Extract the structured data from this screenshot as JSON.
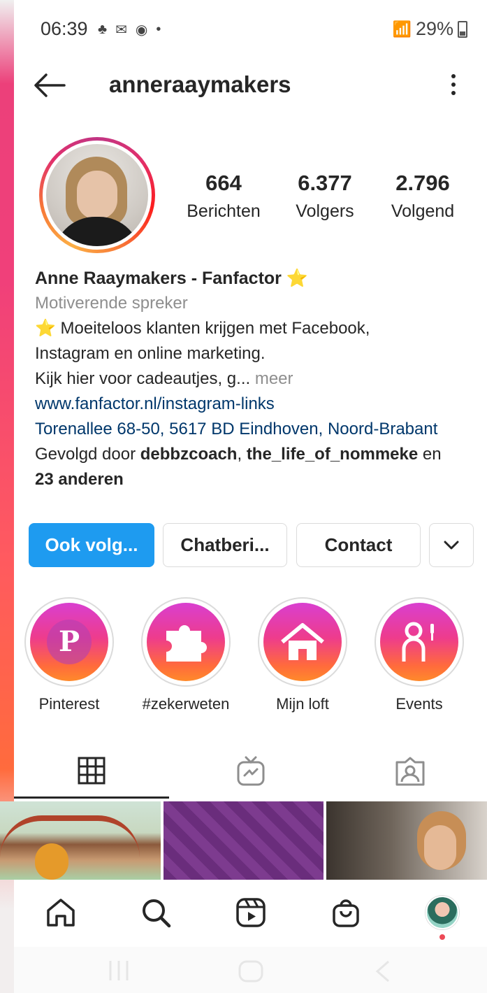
{
  "status_bar": {
    "time": "06:39",
    "battery": "29%"
  },
  "header": {
    "username": "anneraaymakers"
  },
  "profile": {
    "stats": [
      {
        "value": "664",
        "label": "Berichten"
      },
      {
        "value": "6.377",
        "label": "Volgers"
      },
      {
        "value": "2.796",
        "label": "Volgend"
      }
    ],
    "name": "Anne Raaymakers - Fanfactor ⭐",
    "category": "Motiverende spreker",
    "bio_line1": "⭐ Moeiteloos klanten krijgen met Facebook,",
    "bio_line2": "Instagram en online marketing.",
    "bio_line3": "Kijk hier voor cadeautjes, g...",
    "more": " meer",
    "link": "www.fanfactor.nl/instagram-links",
    "address": "Torenallee 68-50, 5617 BD Eindhoven, Noord-Brabant",
    "followed_prefix": "Gevolgd door ",
    "followed_user1": "debbzcoach",
    "followed_sep": ", ",
    "followed_user2": "the_life_of_nommeke",
    "followed_and": " en",
    "followed_others": "23 anderen"
  },
  "actions": {
    "follow": "Ook volg...",
    "chat": "Chatberi...",
    "contact": "Contact"
  },
  "highlights": [
    {
      "label": "Pinterest",
      "icon": "pinterest-icon"
    },
    {
      "label": "#zekerweten",
      "icon": "puzzle-icon"
    },
    {
      "label": "Mijn loft",
      "icon": "home-icon"
    },
    {
      "label": "Events",
      "icon": "person-mic-icon"
    }
  ],
  "tabs": [
    "grid-icon",
    "igtv-icon",
    "tagged-icon"
  ],
  "bottom_nav": [
    "home-icon",
    "search-icon",
    "reels-icon",
    "shop-icon",
    "profile-avatar"
  ]
}
